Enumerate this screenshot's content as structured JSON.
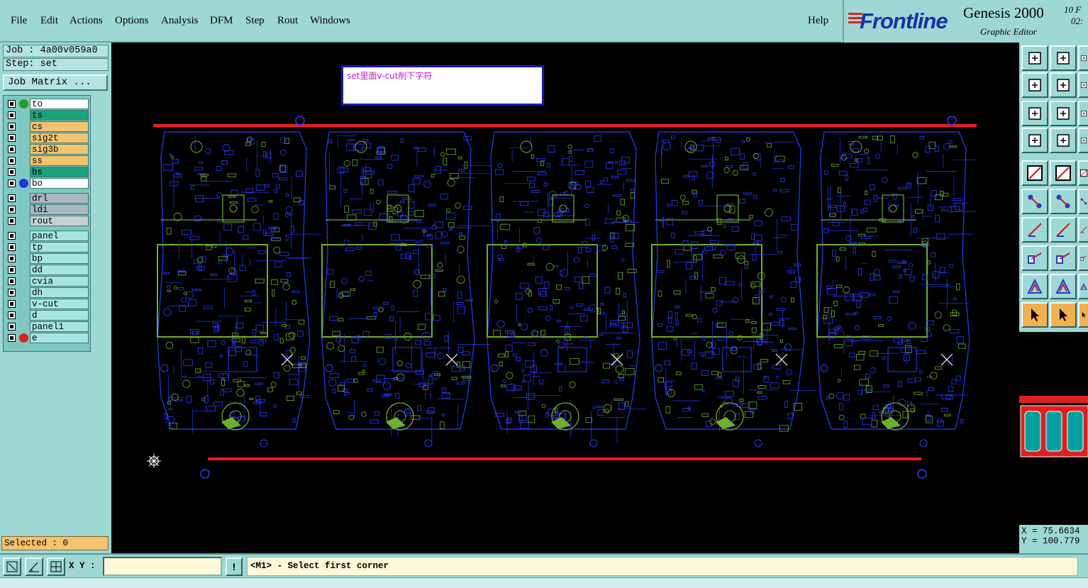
{
  "menu": {
    "items": [
      "File",
      "Edit",
      "Actions",
      "Options",
      "Analysis",
      "DFM",
      "Step",
      "Rout",
      "Windows"
    ],
    "help": "Help"
  },
  "logo": {
    "brand": "Frontline",
    "product": "Genesis 2000",
    "subtitle": "Graphic Editor",
    "date_line1": "10 F",
    "date_line2": "02:"
  },
  "left_panel": {
    "job": "Job : 4a00v059a0",
    "step": "Step: set",
    "job_matrix_label": "Job Matrix ...",
    "layers": [
      {
        "name": "to",
        "color": "#ffffff",
        "dot": "#22a022"
      },
      {
        "name": "ts",
        "color": "#1aa37a",
        "dot": ""
      },
      {
        "name": "cs",
        "color": "#f5c36b",
        "dot": ""
      },
      {
        "name": "sig2t",
        "color": "#f5c36b",
        "dot": ""
      },
      {
        "name": "sig3b",
        "color": "#f5c36b",
        "dot": ""
      },
      {
        "name": "ss",
        "color": "#f5c36b",
        "dot": ""
      },
      {
        "name": "bs",
        "color": "#1aa37a",
        "dot": ""
      },
      {
        "name": "bo",
        "color": "#ffffff",
        "dot": "#1a3ae0"
      },
      {
        "name": "drl",
        "color": "#a8b8c0",
        "dot": ""
      },
      {
        "name": "ldi",
        "color": "#a8b8c0",
        "dot": ""
      },
      {
        "name": "rout",
        "color": "#c8d0d0",
        "dot": ""
      },
      {
        "name": "panel",
        "color": "#a8e4e0",
        "dot": ""
      },
      {
        "name": "tp",
        "color": "#a8e4e0",
        "dot": ""
      },
      {
        "name": "bp",
        "color": "#a8e4e0",
        "dot": ""
      },
      {
        "name": "dd",
        "color": "#a8e4e0",
        "dot": ""
      },
      {
        "name": "cvia",
        "color": "#a8e4e0",
        "dot": ""
      },
      {
        "name": "dh",
        "color": "#a8e4e0",
        "dot": ""
      },
      {
        "name": "v-cut",
        "color": "#a8e4e0",
        "dot": ""
      },
      {
        "name": "d",
        "color": "#a8e4e0",
        "dot": ""
      },
      {
        "name": "panel1",
        "color": "#a8e4e0",
        "dot": ""
      },
      {
        "name": "e",
        "color": "#a8e4e0",
        "dot": "#e02020"
      }
    ],
    "selected": "Selected : 0"
  },
  "canvas": {
    "note": "set里面v-cut削下字符"
  },
  "coords": {
    "x": "X = 75.6634",
    "y": "Y = 100.779"
  },
  "status": {
    "xy_label": "X Y :",
    "xy_value": "",
    "prompt": "<M1> - Select first corner"
  }
}
